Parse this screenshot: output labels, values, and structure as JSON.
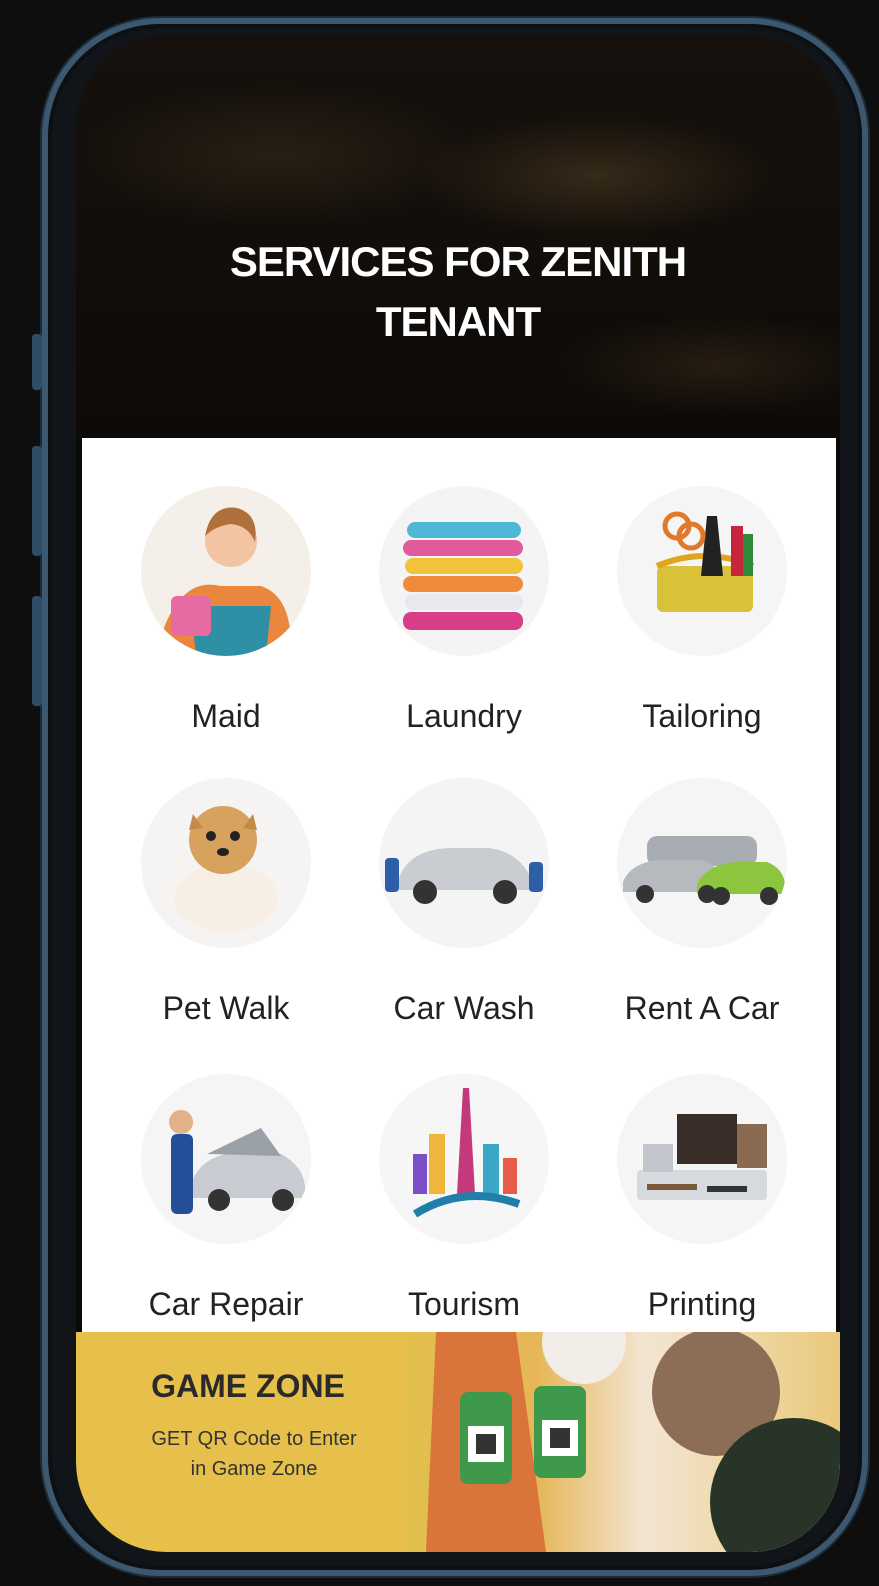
{
  "header": {
    "title_line1": "SERVICES FOR ZENITH",
    "title_line2": "TENANT"
  },
  "services": [
    {
      "label": "Maid",
      "icon": "maid-icon"
    },
    {
      "label": "Laundry",
      "icon": "laundry-icon"
    },
    {
      "label": "Tailoring",
      "icon": "tailoring-icon"
    },
    {
      "label": "Pet Walk",
      "icon": "pet-walk-icon"
    },
    {
      "label": "Car Wash",
      "icon": "car-wash-icon"
    },
    {
      "label": "Rent A Car",
      "icon": "rent-a-car-icon"
    },
    {
      "label": "Car Repair",
      "icon": "car-repair-icon"
    },
    {
      "label": "Tourism",
      "icon": "tourism-icon"
    },
    {
      "label": "Printing",
      "icon": "printing-icon"
    }
  ],
  "banner": {
    "title": "GAME ZONE",
    "subtitle_line1": "GET QR Code to Enter",
    "subtitle_line2": "in Game Zone"
  },
  "colors": {
    "frame": "#3b5870",
    "banner_bg": "#e6c04a",
    "panel_bg": "#ffffff"
  }
}
